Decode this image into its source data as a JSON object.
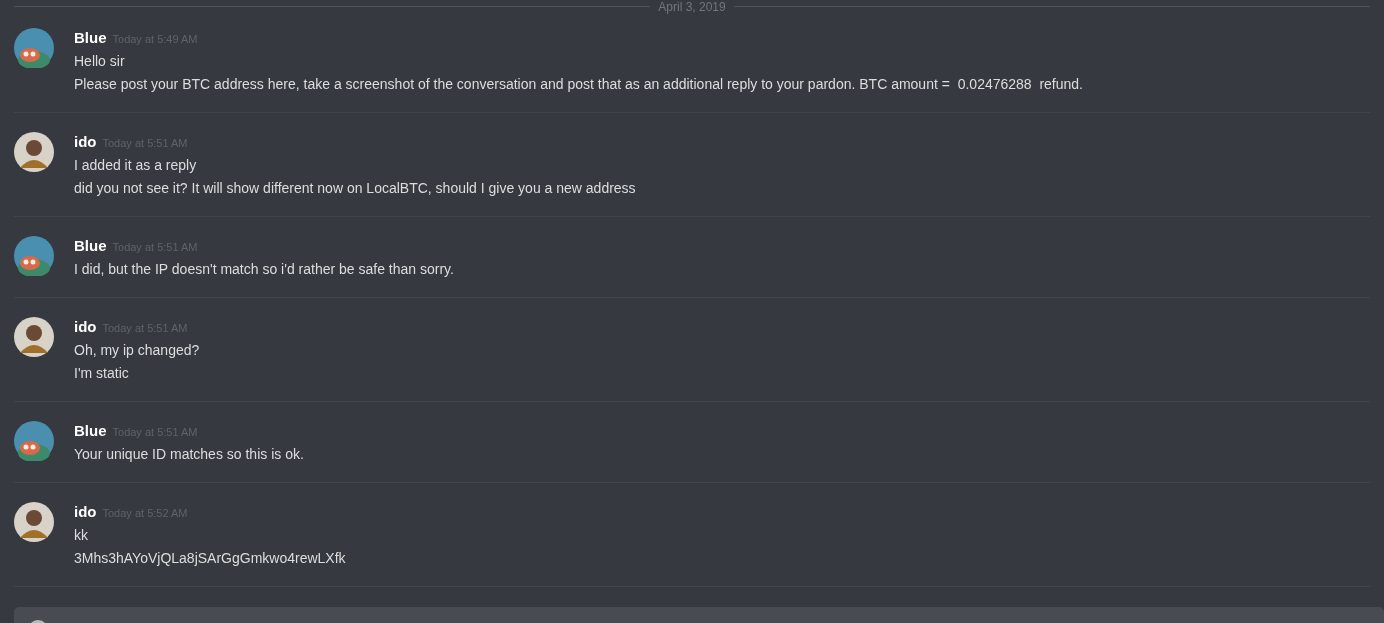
{
  "date_divider": "April 3, 2019",
  "messages": [
    {
      "author": "Blue",
      "kind": "cartoon",
      "time": "Today at 5:49 AM",
      "lines": [
        "Hello sir",
        "Please post your BTC address here, take a screenshot of the conversation and post that as an additional reply to your pardon. BTC amount =  0.02476288  refund."
      ]
    },
    {
      "author": "ido",
      "kind": "person",
      "time": "Today at 5:51 AM",
      "lines": [
        "I added it as a reply",
        "did you not see it? It will show different now on LocalBTC, should I give you a new address"
      ]
    },
    {
      "author": "Blue",
      "kind": "cartoon",
      "time": "Today at 5:51 AM",
      "lines": [
        "I did, but the IP doesn't match so i'd rather be safe than sorry."
      ]
    },
    {
      "author": "ido",
      "kind": "person",
      "time": "Today at 5:51 AM",
      "lines": [
        "Oh, my ip changed?",
        "I'm static"
      ]
    },
    {
      "author": "Blue",
      "kind": "cartoon",
      "time": "Today at 5:51 AM",
      "lines": [
        "Your unique ID matches so this is ok."
      ]
    },
    {
      "author": "ido",
      "kind": "person",
      "time": "Today at 5:52 AM",
      "lines": [
        "kk",
        "3Mhs3hAYoVjQLa8jSArGgGmkwo4rewLXfk"
      ]
    }
  ]
}
